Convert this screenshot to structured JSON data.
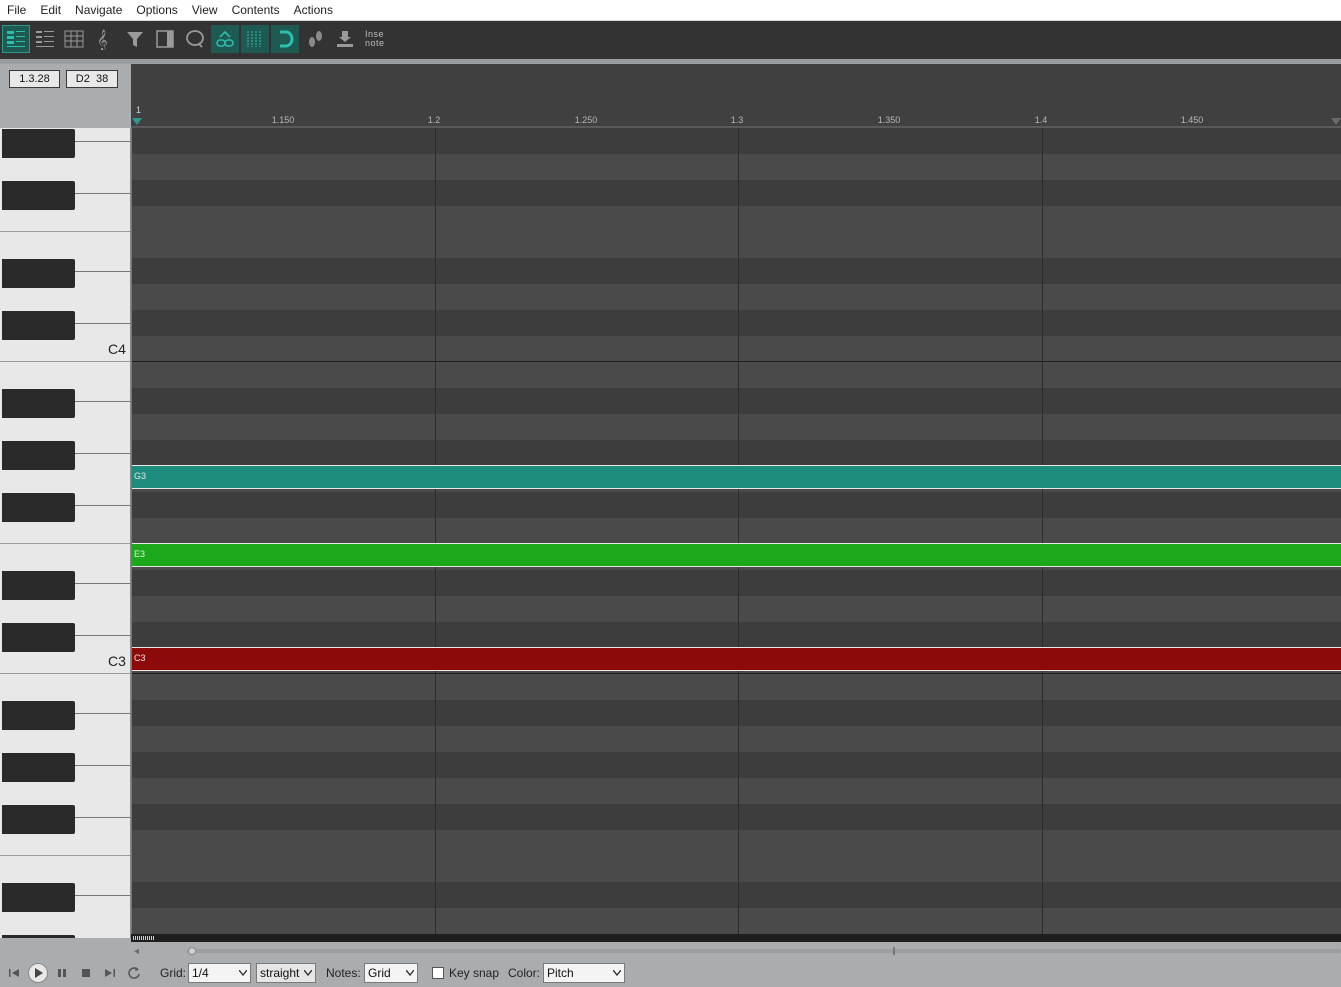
{
  "menu": [
    "File",
    "Edit",
    "Navigate",
    "Options",
    "View",
    "Contents",
    "Actions"
  ],
  "toolbar": {
    "insert_label_line1": "Inse",
    "insert_label_line2": "note",
    "accent_color": "#2b9a8c"
  },
  "position": {
    "cursor_pos": "1.3.28",
    "note_under_cursor": "D2  38"
  },
  "ruler": {
    "start_label": "1",
    "labels": [
      "1.150",
      "1.2",
      "1.250",
      "1.3",
      "1.350",
      "1.4",
      "1.450"
    ]
  },
  "keyboard": {
    "labels": [
      "C4",
      "C3"
    ]
  },
  "notes": [
    {
      "name": "G3",
      "color": "#1e8c7c"
    },
    {
      "name": "E3",
      "color": "#1ba81b"
    },
    {
      "name": "C3",
      "color": "#8c0a0a"
    }
  ],
  "bottom": {
    "grid_label": "Grid:",
    "grid_value": "1/4",
    "grid_type": "straight",
    "notes_label": "Notes:",
    "notes_value": "Grid",
    "keysnap_label": "Key snap",
    "keysnap_checked": false,
    "color_label": "Color:",
    "color_value": "Pitch"
  }
}
